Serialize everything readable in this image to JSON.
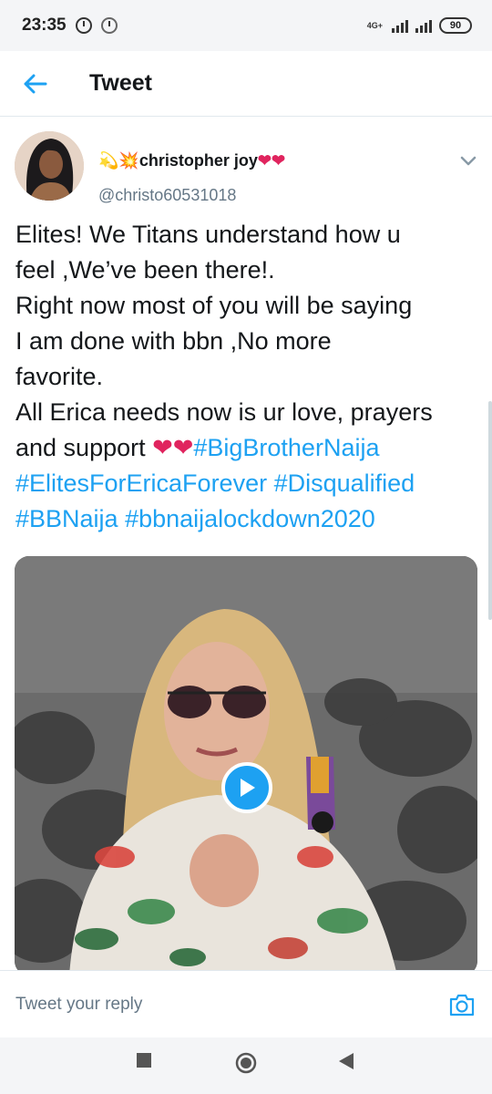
{
  "status_bar": {
    "time": "23:35",
    "network": "4G+",
    "battery": "90"
  },
  "header": {
    "title": "Tweet"
  },
  "author": {
    "name": "christopher joy",
    "handle": "@christo60531018"
  },
  "tweet": {
    "lines": [
      [
        "Elites! We Titans understand how u"
      ],
      [
        "feel ,We’ve been there!."
      ],
      [
        "Right now most of you will be saying"
      ],
      [
        "I am done with bbn ,No more"
      ],
      [
        "favorite."
      ],
      [
        "All Erica needs now is ur love, prayers"
      ]
    ],
    "line7_text": "and support ",
    "hashtags": {
      "h1": "#BigBrotherNaija",
      "h2": "#ElitesForEricaForever",
      "h3": "#Disqualified",
      "h4": "#BBNaija",
      "h5": "#bbnaijalockdown2020"
    }
  },
  "reply": {
    "placeholder": "Tweet your reply"
  },
  "colors": {
    "accent": "#1da1f2",
    "heart": "#e0245e",
    "text": "#14171a",
    "muted": "#657786"
  },
  "icons": [
    "back-arrow-icon",
    "chevron-down-icon",
    "play-icon",
    "camera-icon",
    "nav-recents-icon",
    "nav-home-icon",
    "nav-back-icon"
  ]
}
